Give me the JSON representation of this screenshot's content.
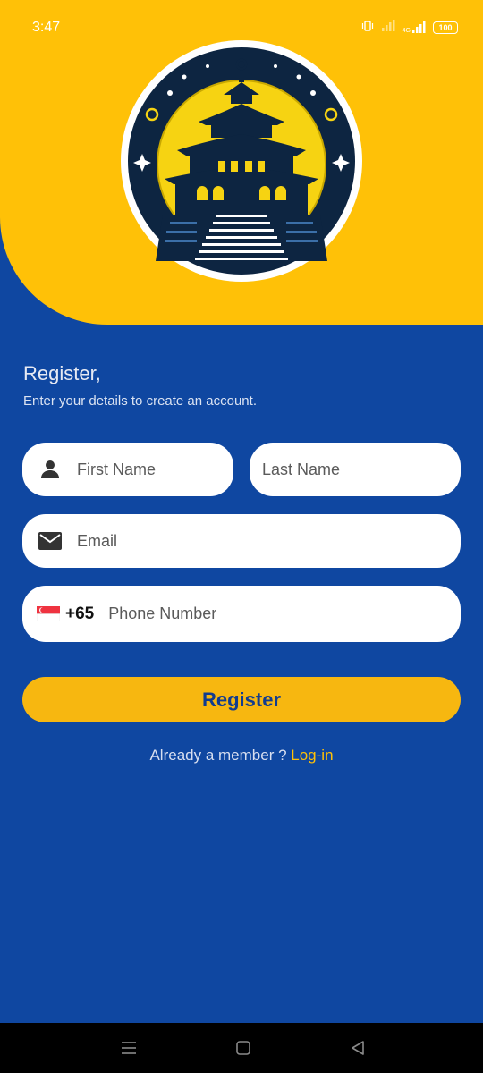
{
  "status_bar": {
    "time": "3:47",
    "network": "4G",
    "battery": "100"
  },
  "form": {
    "title": "Register,",
    "subtitle": "Enter your details to create an account.",
    "first_name_placeholder": "First Name",
    "last_name_placeholder": "Last Name",
    "email_placeholder": "Email",
    "country_code": "+65",
    "phone_placeholder": "Phone Number",
    "register_label": "Register"
  },
  "login_prompt": {
    "text": "Already a member ? ",
    "link": "Log-in"
  },
  "icons": {
    "first_name": "person-icon",
    "email": "mail-icon",
    "flag": "singapore-flag-icon",
    "nav_menu": "menu-icon",
    "nav_home": "home-square-icon",
    "nav_back": "back-triangle-icon"
  },
  "colors": {
    "background": "#0f47a1",
    "header": "#ffc107",
    "button": "#f7b710",
    "button_text": "#123c8f",
    "link": "#ffc107"
  }
}
